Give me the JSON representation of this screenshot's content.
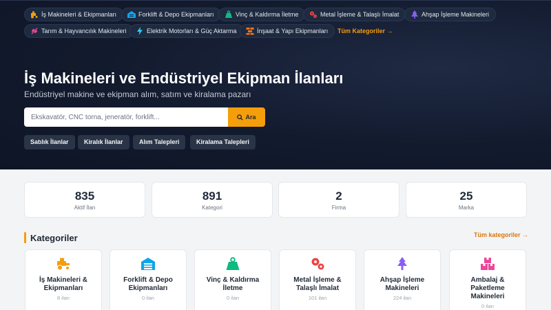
{
  "nav_chips": [
    {
      "label": "İş Makineleri & Ekipmanları",
      "icon": "tractor-icon"
    },
    {
      "label": "Forklift & Depo Ekipmanları",
      "icon": "warehouse-icon"
    },
    {
      "label": "Vinç & Kaldırma İletme",
      "icon": "weight-icon"
    },
    {
      "label": "Metal İşleme & Talaşlı İmalat",
      "icon": "gears-icon"
    },
    {
      "label": "Ahşap İşleme Makineleri",
      "icon": "tree-icon"
    },
    {
      "label": "Tarım & Hayvancılık Makineleri",
      "icon": "seedling-icon"
    },
    {
      "label": "Elektrik Motorları & Güç Aktarma",
      "icon": "bolt-icon"
    },
    {
      "label": "İnşaat & Yapı Ekipmanları",
      "icon": "bricks-icon"
    }
  ],
  "all_categories_chip": "Tüm Kategoriler →",
  "hero": {
    "title": "İş Makineleri ve Endüstriyel Ekipman İlanları",
    "subtitle": "Endüstriyel makine ve ekipman alım, satım ve kiralama pazarı"
  },
  "search": {
    "placeholder": "Ekskavatör, CNC torna, jeneratör, forklift...",
    "button_label": "Ara"
  },
  "quick_filters": [
    "Satılık İlanlar",
    "Kiralık İlanlar",
    "Alım Talepleri",
    "Kiralama Talepleri"
  ],
  "stats": [
    {
      "value": "835",
      "label": "Aktif İlan"
    },
    {
      "value": "891",
      "label": "Kategori"
    },
    {
      "value": "2",
      "label": "Firma"
    },
    {
      "value": "25",
      "label": "Marka"
    }
  ],
  "categories_section": {
    "title": "Kategoriler",
    "link_label": "Tüm kategoriler →",
    "items": [
      {
        "name": "İş Makineleri & Ekipmanları",
        "count": "8 ilan",
        "icon": "tractor-icon",
        "color": "#f59e0b"
      },
      {
        "name": "Forklift & Depo Ekipmanları",
        "count": "0 ilan",
        "icon": "warehouse-icon",
        "color": "#0ea5e9"
      },
      {
        "name": "Vinç & Kaldırma İletme",
        "count": "0 ilan",
        "icon": "weight-icon",
        "color": "#10b981"
      },
      {
        "name": "Metal İşleme & Talaşlı İmalat",
        "count": "101 ilan",
        "icon": "gears-icon",
        "color": "#ef4444"
      },
      {
        "name": "Ahşap İşleme Makineleri",
        "count": "224 ilan",
        "icon": "tree-icon",
        "color": "#8b5cf6"
      },
      {
        "name": "Ambalaj & Paketleme Makineleri",
        "count": "0 ilan",
        "icon": "boxes-icon",
        "color": "#ec4899"
      }
    ]
  },
  "colors": {
    "accent": "#f59e0b",
    "hero_bg": "#121a2d",
    "page_bg": "#f3f4f6"
  }
}
